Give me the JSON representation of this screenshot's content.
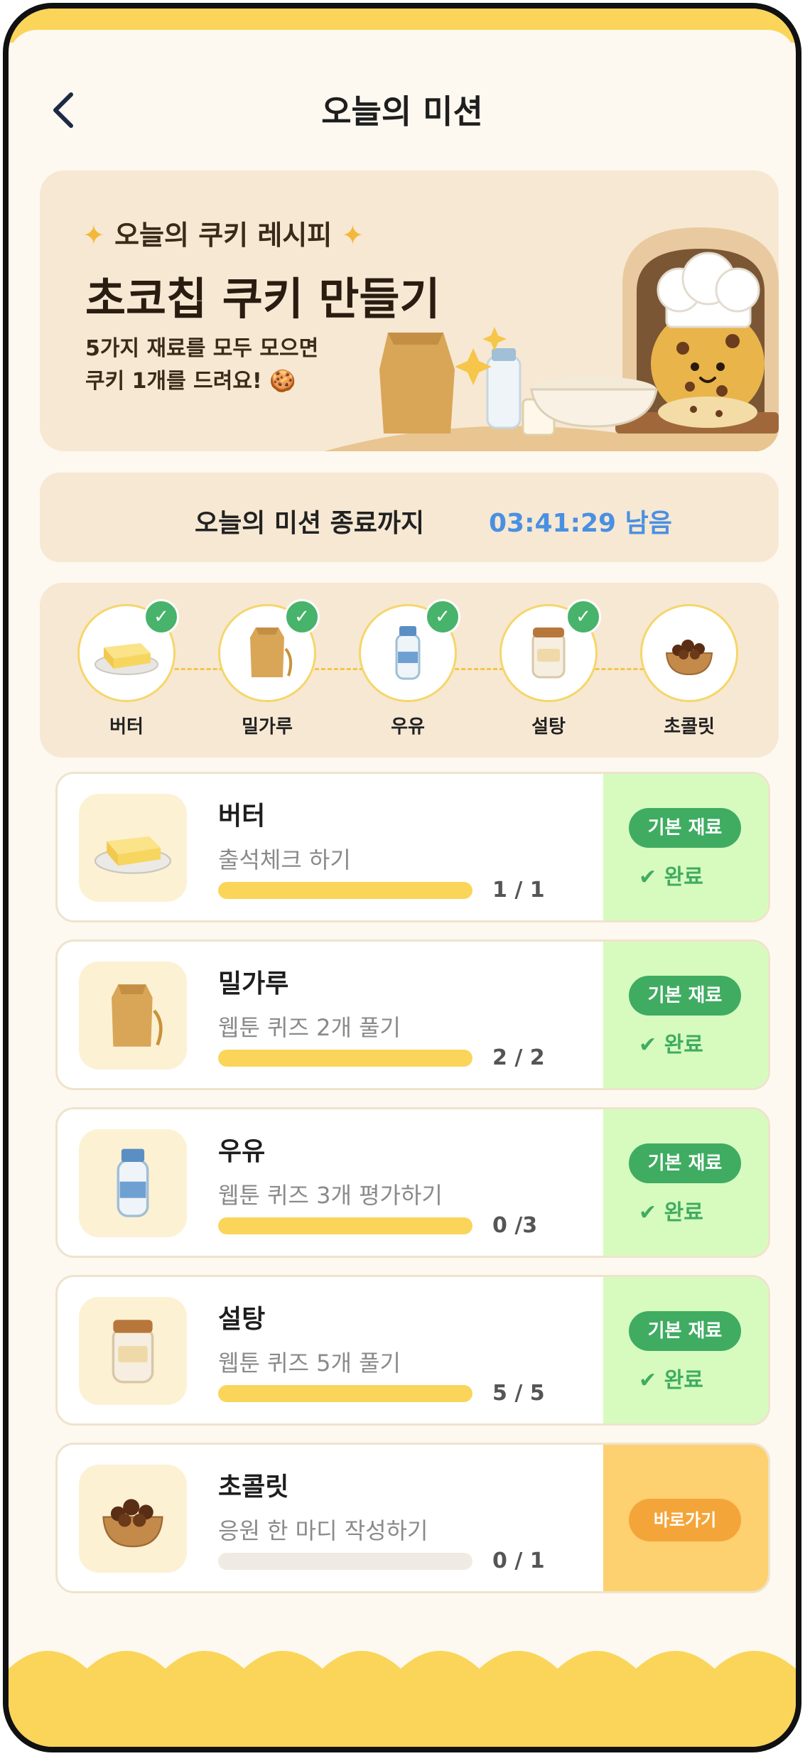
{
  "header": {
    "title": "오늘의 미션"
  },
  "hero": {
    "subtitle": "오늘의 쿠키 레시피",
    "title": "초코칩 쿠키 만들기",
    "desc_line1": "5가지 재료를 모두 모으면",
    "desc_line2": "쿠키 1개를 드려요! 🍪"
  },
  "timer": {
    "label": "오늘의 미션 종료까지",
    "value": "03:41:29 남음"
  },
  "steps": [
    {
      "label": "버터",
      "icon": "butter-icon",
      "done": true
    },
    {
      "label": "밀가루",
      "icon": "flour-icon",
      "done": true
    },
    {
      "label": "우유",
      "icon": "milk-icon",
      "done": true
    },
    {
      "label": "설탕",
      "icon": "sugar-icon",
      "done": true
    },
    {
      "label": "초콜릿",
      "icon": "chocolate-icon",
      "done": false
    }
  ],
  "missions": [
    {
      "name": "버터",
      "desc": "출석체크 하기",
      "count": "1 / 1",
      "progress": 1.0,
      "tag": "기본 재료",
      "status": "완료"
    },
    {
      "name": "밀가루",
      "desc": "웹툰 퀴즈 2개 풀기",
      "count": "2 / 2",
      "progress": 1.0,
      "tag": "기본 재료",
      "status": "완료"
    },
    {
      "name": "우유",
      "desc": "웹툰 퀴즈 3개 평가하기",
      "count": "0 /3",
      "progress": 1.0,
      "tag": "기본 재료",
      "status": "완료"
    },
    {
      "name": "설탕",
      "desc": "웹툰 퀴즈 5개 풀기",
      "count": "5 / 5",
      "progress": 1.0,
      "tag": "기본 재료",
      "status": "완료"
    },
    {
      "name": "초콜릿",
      "desc": "응원 한 마디 작성하기",
      "count": "0 / 1",
      "progress": 0.0,
      "button": "바로가기"
    }
  ],
  "colors": {
    "accent": "#fad55a",
    "done": "#3fac62",
    "timer": "#4a90e2",
    "go": "#f4a53a"
  }
}
